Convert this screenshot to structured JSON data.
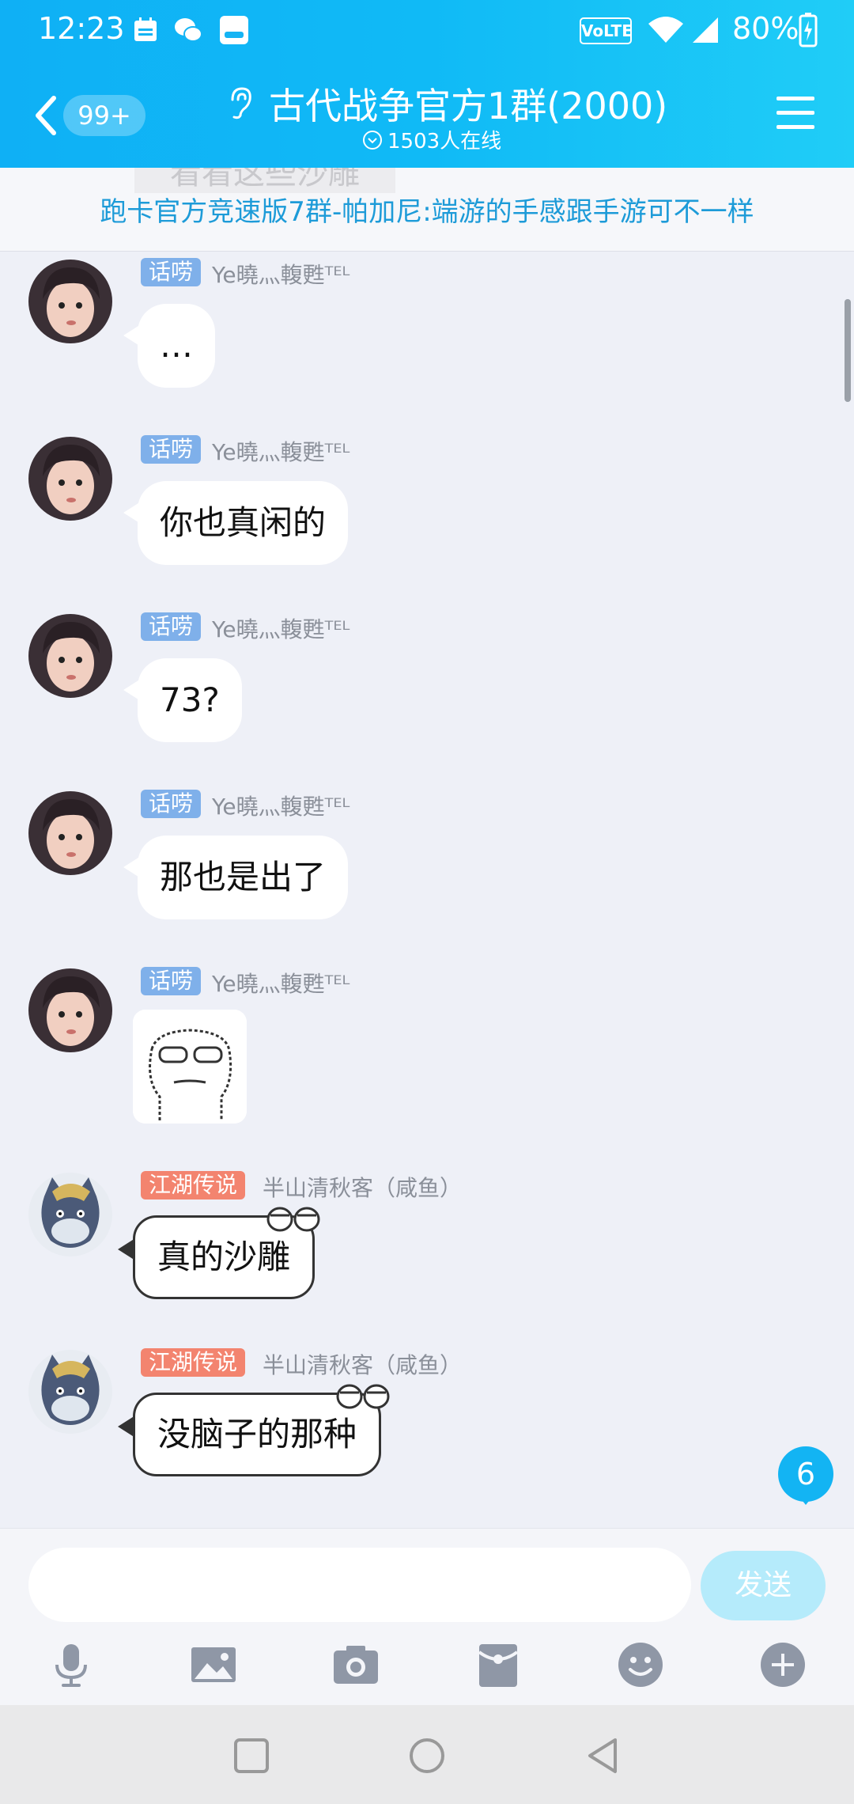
{
  "status_bar": {
    "time": "12:23",
    "battery": "80%",
    "volte": "VoLTE"
  },
  "header": {
    "back_badge": "99+",
    "title": "古代战争官方1群(2000)",
    "online": "1503人在线"
  },
  "announcement": {
    "ghost_text": "看看这些沙雕",
    "text": "跑卡官方竞速版7群-帕加尼:端游的手感跟手游可不一样"
  },
  "messages": [
    {
      "tag": "话唠",
      "tag_color": "#7fb0ea",
      "nick": "Ye曉灬輹甦ᵀᴱᴸ",
      "text": "…",
      "type": "text"
    },
    {
      "tag": "话唠",
      "tag_color": "#7fb0ea",
      "nick": "Ye曉灬輹甦ᵀᴱᴸ",
      "text": "你也真闲的",
      "type": "text"
    },
    {
      "tag": "话唠",
      "tag_color": "#7fb0ea",
      "nick": "Ye曉灬輹甦ᵀᴱᴸ",
      "text": "73?",
      "type": "text"
    },
    {
      "tag": "话唠",
      "tag_color": "#7fb0ea",
      "nick": "Ye曉灬輹甦ᵀᴱᴸ",
      "text": "那也是出了",
      "type": "text"
    },
    {
      "tag": "话唠",
      "tag_color": "#7fb0ea",
      "nick": "Ye曉灬輹甦ᵀᴱᴸ",
      "type": "sticker"
    },
    {
      "tag": "江湖传说",
      "tag_color": "#f3846f",
      "nick": "半山清秋客（咸鱼）",
      "text": "真的沙雕",
      "type": "text"
    },
    {
      "tag": "江湖传说",
      "tag_color": "#f3846f",
      "nick": "半山清秋客（咸鱼）",
      "text": "没脑子的那种",
      "type": "text"
    }
  ],
  "unread_count": "6",
  "input": {
    "placeholder": "",
    "send_label": "发送"
  },
  "toolbar": [
    "mic-icon",
    "image-icon",
    "camera-icon",
    "red-packet-icon",
    "emoji-icon",
    "plus-icon"
  ],
  "colors": {
    "header": "#10baf6",
    "accent": "#13b4f3",
    "announcement_text": "#1d9bd8"
  }
}
